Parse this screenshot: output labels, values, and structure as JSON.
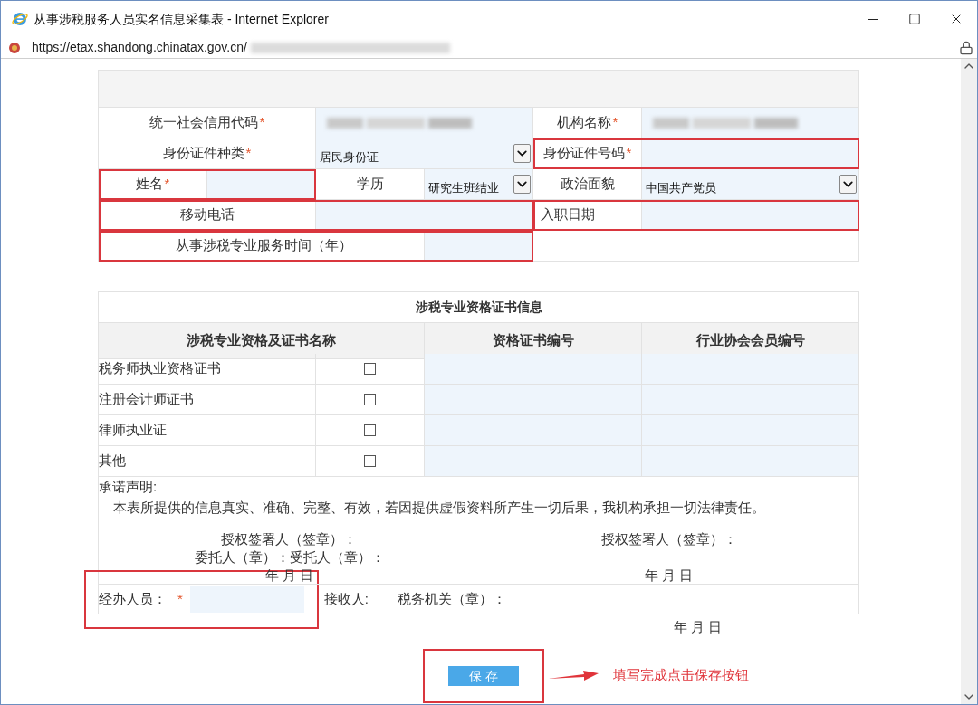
{
  "window": {
    "title": "从事涉税服务人员实名信息采集表 - Internet Explorer",
    "address": "https://etax.shandong.chinatax.gov.cn/"
  },
  "basic_info": {
    "credit_code": {
      "label": "统一社会信用代码",
      "mark": "*"
    },
    "org_name": {
      "label": "机构名称",
      "mark": "*"
    },
    "id_type": {
      "label": "身份证件种类",
      "mark": "*",
      "value": "居民身份证"
    },
    "id_number": {
      "label": "身份证件号码",
      "mark": "*",
      "highlighted": true
    },
    "name": {
      "label": "姓名",
      "mark": "*",
      "highlighted": true
    },
    "education": {
      "label": "学历",
      "value": "研究生班结业"
    },
    "political_status": {
      "label": "政治面貌",
      "value": "中国共产党员"
    },
    "mobile": {
      "label": "移动电话",
      "highlighted": true
    },
    "hire_date": {
      "label": "入职日期",
      "highlighted": true
    },
    "service_years": {
      "label": "从事涉税专业服务时间（年）",
      "highlighted": true
    }
  },
  "certificates": {
    "title": "涉税专业资格证书信息",
    "columns": [
      "涉税专业资格及证书名称",
      "资格证书编号",
      "行业协会会员编号"
    ],
    "rows": [
      {
        "name": "税务师执业资格证书",
        "checked": false
      },
      {
        "name": "注册会计师证书",
        "checked": false
      },
      {
        "name": "律师执业证",
        "checked": false
      },
      {
        "name": "其他",
        "checked": false
      }
    ]
  },
  "statement": {
    "heading": "承诺声明:",
    "text": "本表所提供的信息真实、准确、完整、有效，若因提供虚假资料所产生一切后果，我机构承担一切法律责任。",
    "signer_left": "授权签署人（签章）：",
    "delegate": "委托人（章）：受托人（章）：",
    "date_left": "年 月 日",
    "signer_right": "授权签署人（签章）：",
    "date_right": "年 月 日"
  },
  "handler": {
    "label": "经办人员：",
    "mark": "*",
    "highlighted": true,
    "receiver": "接收人:",
    "tax_office": "税务机关（章）：",
    "date": "年 月 日"
  },
  "save_button": {
    "label": "保 存",
    "highlighted": true
  },
  "callout": "填写完成点击保存按钮"
}
